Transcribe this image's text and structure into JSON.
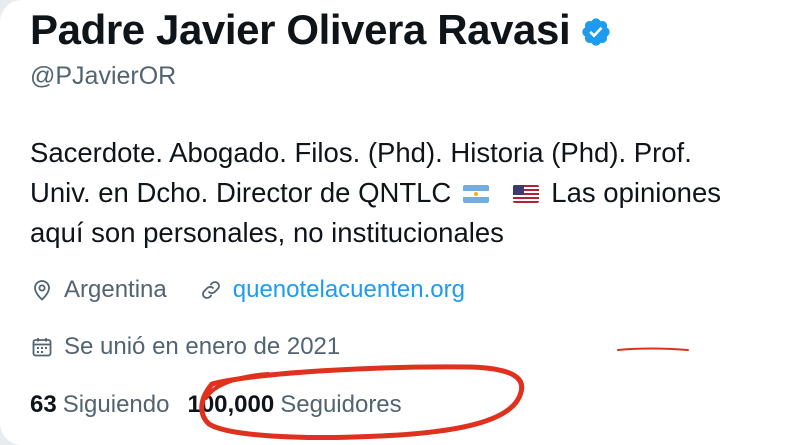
{
  "profile": {
    "display_name": "Padre Javier Olivera Ravasi",
    "handle": "@PJavierOR",
    "bio_line_1": "Sacerdote. Abogado. Filos. (Phd). Historia (Phd). Prof.",
    "bio_line_2_start": "Univ. en Dcho. Director de QNTLC",
    "bio_line_2_end": "Las opiniones",
    "bio_line_3": "aquí son personales, no institucionales",
    "location": "Argentina",
    "website": "quenotelacuenten.org",
    "joined": "Se unió en enero de 2021",
    "following_count": "63",
    "following_label": "Siguiendo",
    "followers_count": "100,000",
    "followers_label": "Seguidores"
  },
  "icons": {
    "verified": "verified-badge-icon",
    "location": "location-pin-icon",
    "link": "link-icon",
    "calendar": "calendar-icon",
    "flag_1": "argentina-flag-icon",
    "flag_2": "usa-flag-icon"
  },
  "colors": {
    "text": "#0f1419",
    "secondary": "#536471",
    "link": "#1d9bf0",
    "annotation": "#e0301e"
  }
}
